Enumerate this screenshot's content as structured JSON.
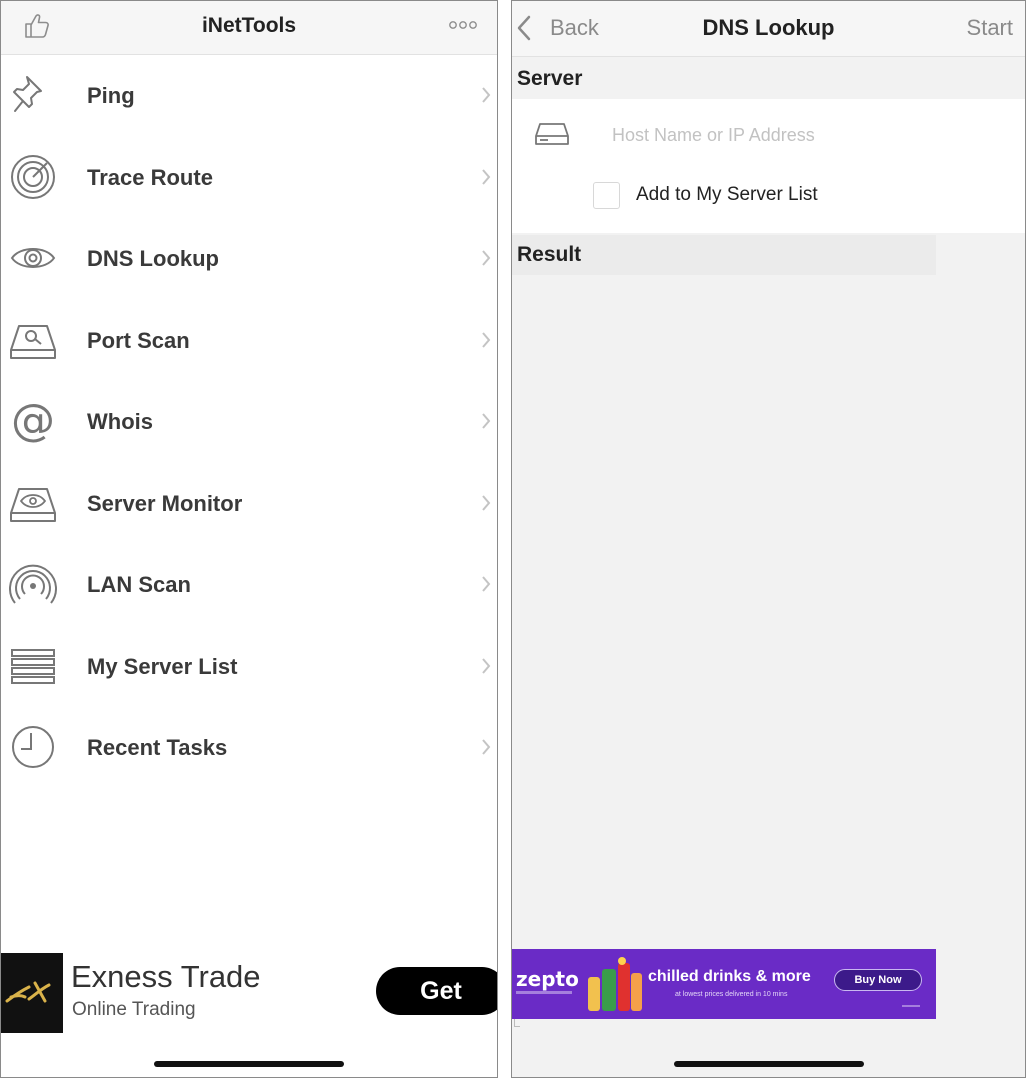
{
  "left_screen": {
    "header": {
      "title": "iNetTools",
      "left_icon": "thumbs-up-icon",
      "right_icon": "more-dots-icon"
    },
    "menu": [
      {
        "label": "Ping",
        "icon": "pushpin-icon"
      },
      {
        "label": "Trace Route",
        "icon": "radar-icon"
      },
      {
        "label": "DNS Lookup",
        "icon": "eye-icon"
      },
      {
        "label": "Port Scan",
        "icon": "drive-search-icon"
      },
      {
        "label": "Whois",
        "icon": "at-sign-icon"
      },
      {
        "label": "Server Monitor",
        "icon": "drive-eye-icon"
      },
      {
        "label": "LAN Scan",
        "icon": "signal-icon"
      },
      {
        "label": "My Server List",
        "icon": "list-icon"
      },
      {
        "label": "Recent Tasks",
        "icon": "clock-icon"
      }
    ],
    "ad": {
      "title": "Exness Trade",
      "subtitle": "Online Trading",
      "button_label": "Get"
    }
  },
  "right_screen": {
    "header": {
      "back_label": "Back",
      "title": "DNS Lookup",
      "action_label": "Start"
    },
    "server_section": {
      "header": "Server",
      "host_value": "",
      "host_placeholder": "Host Name or IP Address",
      "checkbox_label": "Add to My Server List",
      "checkbox_checked": false
    },
    "result_section": {
      "header": "Result"
    },
    "ad": {
      "brand": "zepto",
      "headline": "chilled drinks & more",
      "subline": "at lowest prices delivered in 10 mins",
      "button_label": "Buy Now",
      "background_color": "#6a2bc6"
    }
  }
}
